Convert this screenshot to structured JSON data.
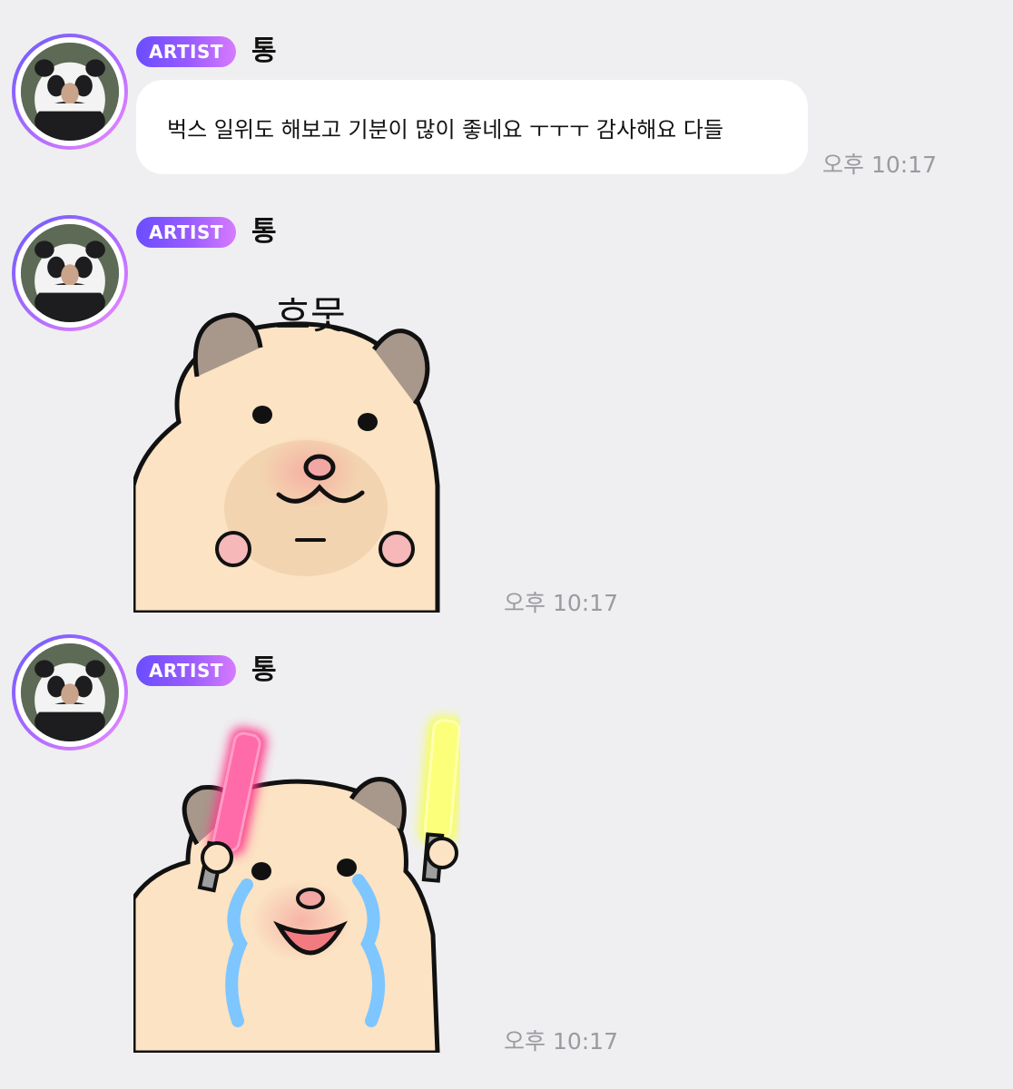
{
  "messages": [
    {
      "badge": "ARTIST",
      "sender": "통",
      "text": "벅스 일위도 해보고 기분이 많이 좋네요 ㅜㅜㅜ 감사해요 다들",
      "time": "오후 10:17"
    },
    {
      "badge": "ARTIST",
      "sender": "통",
      "sticker": {
        "name": "hamster-content-sticker",
        "caption": "흐뭇"
      },
      "time": "오후 10:17"
    },
    {
      "badge": "ARTIST",
      "sender": "통",
      "sticker": {
        "name": "hamster-glowstick-crying-sticker"
      },
      "time": "오후 10:17"
    }
  ],
  "colors": {
    "background": "#efeff1",
    "badge_gradient_start": "#6a4dff",
    "badge_gradient_end": "#d77bff",
    "timestamp": "#9a9aa0"
  },
  "icons": [
    "artist-avatar",
    "artist-badge"
  ]
}
